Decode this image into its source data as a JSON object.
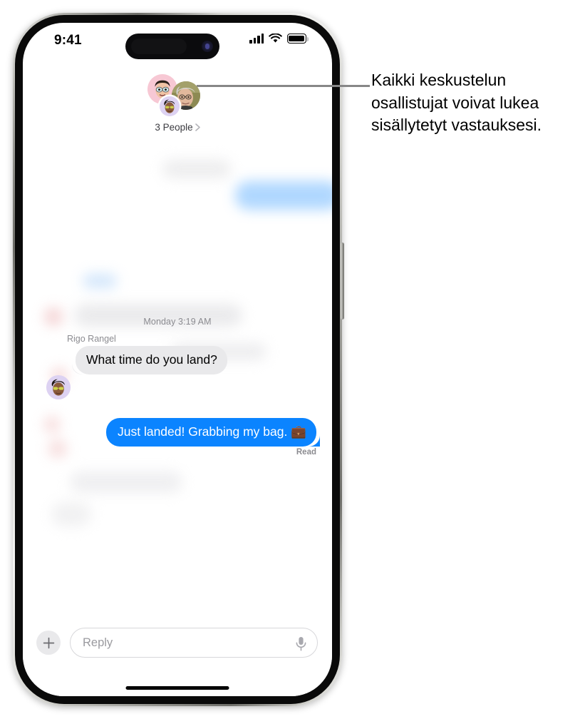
{
  "status_bar": {
    "time": "9:41",
    "signal_icon": "cellular-bars-icon",
    "wifi_icon": "wifi-icon",
    "battery_icon": "battery-icon"
  },
  "participants": {
    "avatars": [
      {
        "name": "avatar-participant-1",
        "type": "memoji",
        "bg": "#f7c8d4"
      },
      {
        "name": "avatar-participant-2",
        "type": "photo",
        "bg": "#8d8a53"
      },
      {
        "name": "avatar-participant-3",
        "type": "memoji",
        "bg": "#ddd2f2"
      }
    ],
    "label": "3 People",
    "chevron_icon": "chevron-right-icon"
  },
  "thread": {
    "timestamp": "Monday 3:19 AM",
    "sender_name": "Rigo Rangel",
    "incoming_message": "What time do you land?",
    "outgoing_message": "Just landed! Grabbing my bag. 💼",
    "delivery_status": "Read"
  },
  "reply_bar": {
    "add_button_icon": "plus-icon",
    "input_value": "",
    "input_placeholder": "Reply",
    "mic_icon": "microphone-icon"
  },
  "callout": {
    "text": "Kaikki keskustelun osallistujat voivat lukea sisällytetyt vastauksesi."
  },
  "colors": {
    "imessage_blue": "#0b84ff",
    "bubble_gray": "#e9e9eb",
    "secondary_text": "#8b8b90",
    "leader_line": "#878787"
  }
}
